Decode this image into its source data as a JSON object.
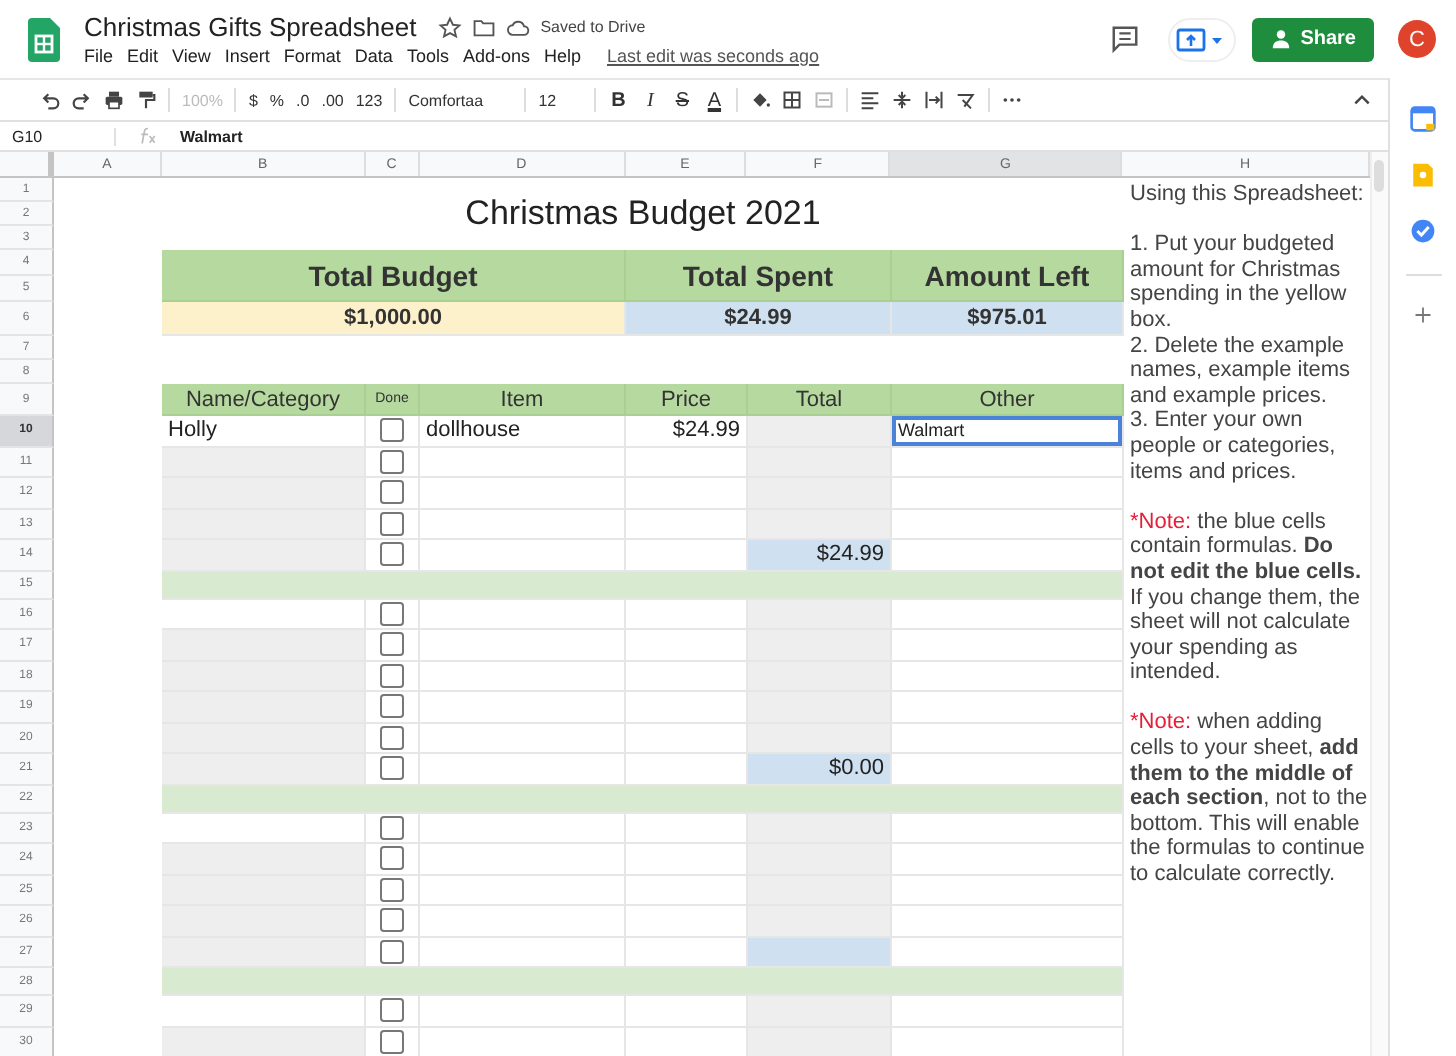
{
  "app": {
    "title": "Christmas Gifts Spreadsheet",
    "save_status": "Saved to Drive",
    "menu": [
      "File",
      "Edit",
      "View",
      "Insert",
      "Format",
      "Data",
      "Tools",
      "Add-ons",
      "Help"
    ],
    "last_edit": "Last edit was seconds ago",
    "share": "Share",
    "avatar": "C"
  },
  "toolbar": {
    "zoom": {
      "label": "100%",
      "disabled": true
    },
    "number_formats": [
      "$",
      "%",
      ".0",
      ".00",
      "123"
    ],
    "font": "Comfortaa",
    "font_size": "12",
    "text_styles": [
      {
        "label": "B",
        "kind": "bold"
      },
      {
        "label": "I",
        "kind": "italic"
      },
      {
        "label": "S",
        "kind": "strike"
      },
      {
        "label": "A",
        "kind": "color"
      }
    ]
  },
  "formula_bar": {
    "cell": "G10",
    "value": "Walmart"
  },
  "sheet": {
    "columns": [
      {
        "label": "A",
        "selected": false
      },
      {
        "label": "B",
        "selected": false
      },
      {
        "label": "C",
        "selected": false
      },
      {
        "label": "D",
        "selected": false
      },
      {
        "label": "E",
        "selected": false
      },
      {
        "label": "F",
        "selected": false
      },
      {
        "label": "G",
        "selected": true
      },
      {
        "label": "H",
        "selected": false
      }
    ],
    "row_numbers": [
      "1",
      "2",
      "3",
      "4",
      "5",
      "6",
      "7",
      "8",
      "9",
      "10",
      "11",
      "12",
      "13",
      "14",
      "15",
      "16",
      "17",
      "18",
      "19",
      "20",
      "21",
      "22",
      "23",
      "24",
      "25",
      "26",
      "27",
      "28",
      "29",
      "30"
    ],
    "title": "Christmas Budget 2021",
    "summary": [
      {
        "label": "Total Budget",
        "value": "$1,000.00",
        "kind": "input"
      },
      {
        "label": "Total Spent",
        "value": "$24.99",
        "kind": "formula"
      },
      {
        "label": "Amount Left",
        "value": "$975.01",
        "kind": "formula"
      }
    ],
    "headers": [
      "Name/Category",
      "Done",
      "Item",
      "Price",
      "Total",
      "Other"
    ],
    "sections": [
      {
        "rows": [
          {
            "kind": "entry",
            "name": "Holly",
            "done": false,
            "item": "dollhouse",
            "price": "$24.99",
            "other": "Walmart",
            "selected": true
          },
          {
            "kind": "entry",
            "done": false,
            "selected": false
          },
          {
            "kind": "entry",
            "done": false,
            "selected": false
          },
          {
            "kind": "entry",
            "done": false,
            "selected": false
          },
          {
            "kind": "total",
            "done": false,
            "total": "$24.99",
            "selected": false
          }
        ]
      },
      {
        "rows": [
          {
            "kind": "entry",
            "done": false,
            "selected": false
          },
          {
            "kind": "entry",
            "done": false,
            "selected": false
          },
          {
            "kind": "entry",
            "done": false,
            "selected": false
          },
          {
            "kind": "entry",
            "done": false,
            "selected": false
          },
          {
            "kind": "entry",
            "done": false,
            "selected": false
          },
          {
            "kind": "total",
            "done": false,
            "total": "$0.00",
            "selected": false
          }
        ]
      },
      {
        "rows": [
          {
            "kind": "entry",
            "done": false,
            "selected": false
          },
          {
            "kind": "entry",
            "done": false,
            "selected": false
          },
          {
            "kind": "entry",
            "done": false,
            "selected": false
          },
          {
            "kind": "entry",
            "done": false,
            "selected": false
          },
          {
            "kind": "total",
            "done": false,
            "selected": false
          }
        ]
      },
      {
        "rows": [
          {
            "kind": "entry",
            "done": false,
            "selected": false
          },
          {
            "kind": "entry",
            "done": false,
            "selected": false
          }
        ]
      }
    ]
  },
  "instructions": {
    "heading": "Using this Spreadsheet:",
    "steps": [
      "1. Put your budgeted amount for Christmas spending in the yellow box.",
      "2. Delete the example names, example items and example prices.",
      "3. Enter your own people or categories, items and prices."
    ],
    "notes": [
      {
        "label": "*Note:",
        "text": "the blue cells contain formulas. **Do not edit the blue cells.** If you change them, the sheet will not calculate your spending as intended."
      },
      {
        "label": "*Note:",
        "text": "when adding cells to your sheet, **add them to the middle of each section**, not to the bottom. This will enable the formulas to continue to calculate correctly."
      }
    ]
  }
}
